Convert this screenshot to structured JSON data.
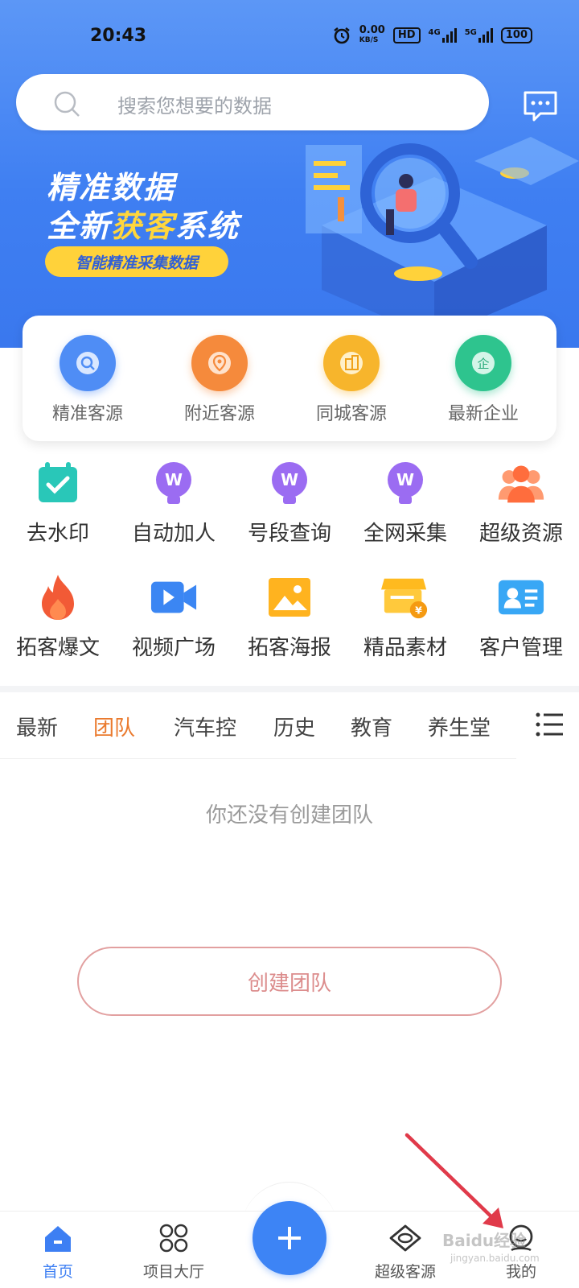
{
  "status_bar": {
    "time": "20:43",
    "net_speed": "0.00",
    "net_unit": "KB/S",
    "hd": "HD",
    "sig1": "4G",
    "sig2": "5G",
    "battery": "100"
  },
  "search": {
    "placeholder": "搜索您想要的数据"
  },
  "banner": {
    "line1": "精准数据",
    "line2_a": "全新",
    "line2_highlight": "获客",
    "line2_b": "系统",
    "tag": "智能精准采集数据"
  },
  "quick_actions": [
    {
      "label": "精准客源",
      "color": "#4f8df5",
      "icon": "search-icon"
    },
    {
      "label": "附近客源",
      "color": "#f58a3c",
      "icon": "location-pin-icon"
    },
    {
      "label": "同城客源",
      "color": "#f7b52c",
      "icon": "building-icon"
    },
    {
      "label": "最新企业",
      "color": "#2ec48e",
      "icon": "enterprise-icon"
    }
  ],
  "tools_row1": [
    {
      "label": "去水印",
      "icon": "calendar-check-icon"
    },
    {
      "label": "自动加人",
      "icon": "w-bulb-icon"
    },
    {
      "label": "号段查询",
      "icon": "w-bulb-icon"
    },
    {
      "label": "全网采集",
      "icon": "w-bulb-icon"
    },
    {
      "label": "超级资源",
      "icon": "people-group-icon"
    }
  ],
  "tools_row2": [
    {
      "label": "拓客爆文",
      "icon": "flame-icon"
    },
    {
      "label": "视频广场",
      "icon": "video-camera-icon"
    },
    {
      "label": "拓客海报",
      "icon": "image-icon"
    },
    {
      "label": "精品素材",
      "icon": "store-coin-icon"
    },
    {
      "label": "客户管理",
      "icon": "contact-card-icon"
    }
  ],
  "tabs": [
    "最新",
    "团队",
    "汽车控",
    "历史",
    "教育",
    "养生堂"
  ],
  "active_tab": "团队",
  "empty_state": {
    "message": "你还没有创建团队",
    "button": "创建团队"
  },
  "bottom_nav": {
    "home": "首页",
    "projects": "项目大厅",
    "resources": "超级客源",
    "mine": "我的"
  },
  "watermark": {
    "text": "Baidu经验",
    "sub": "jingyan.baidu.com"
  },
  "colors": {
    "primary": "#3d7ff3",
    "active_tab": "#ea7a2e",
    "banner_tag": "#ffd23a"
  }
}
